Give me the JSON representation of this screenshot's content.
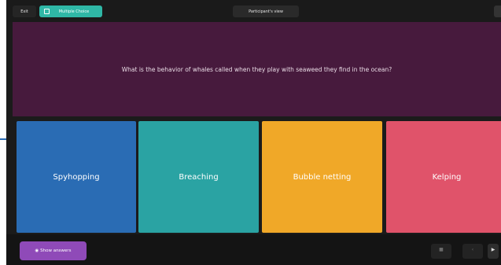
{
  "topbar": {
    "exit_label": "Exit",
    "question_type": "Multiple Choice",
    "view_label": "Participant's view"
  },
  "question": {
    "text": "What is the behavior of whales called when they play with seaweed they find in the ocean?"
  },
  "answers": [
    {
      "label": "Spyhopping",
      "color": "#2a6cb4"
    },
    {
      "label": "Breaching",
      "color": "#2aa3a3"
    },
    {
      "label": "Bubble netting",
      "color": "#f0a828"
    },
    {
      "label": "Kelping",
      "color": "#e0536a"
    }
  ],
  "bottombar": {
    "show_answers_label": "Show answers",
    "show_answers_icon": "eye-icon",
    "controls": [
      {
        "icon": "square-icon"
      },
      {
        "icon": "previous-icon"
      },
      {
        "icon": "next-icon"
      }
    ]
  },
  "colors": {
    "background": "#1b1b1b",
    "question_bg": "#471a3d",
    "accent": "#2fb7a6",
    "show_answers_bg": "#8f4ab8"
  }
}
